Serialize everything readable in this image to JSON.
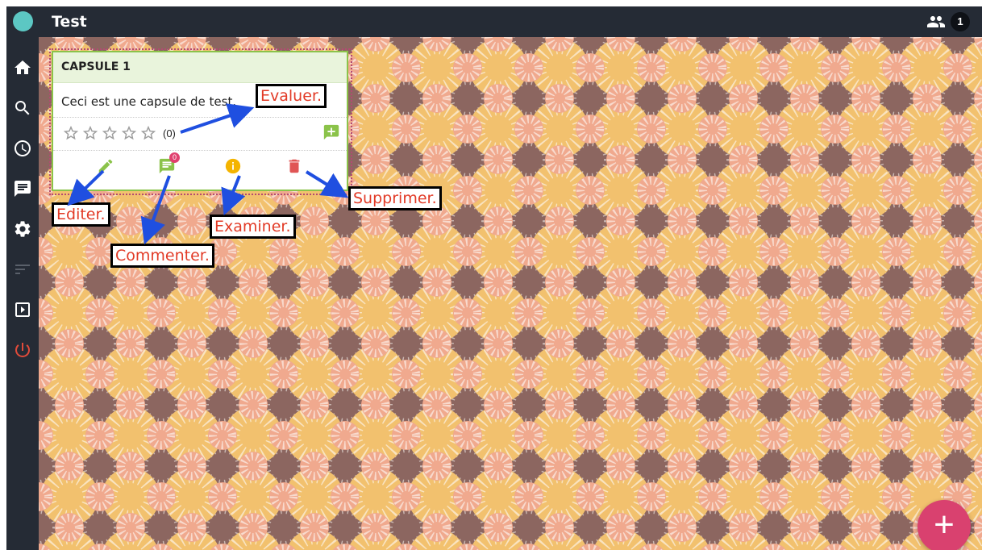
{
  "header": {
    "title": "Test",
    "online_users_count": "1",
    "users_icon": "group-icon"
  },
  "sidebar": {
    "items": [
      {
        "icon": "home-icon"
      },
      {
        "icon": "search-icon"
      },
      {
        "icon": "history-icon"
      },
      {
        "icon": "chat-icon"
      },
      {
        "icon": "settings-icon"
      },
      {
        "icon": "sort-icon"
      },
      {
        "icon": "slideshow-icon"
      },
      {
        "icon": "power-icon",
        "color": "#e04b3a"
      }
    ]
  },
  "capsule": {
    "title": "CAPSULE 1",
    "text": "Ceci est une capsule de test.",
    "rating_stars": 0,
    "rating_count": "(0)",
    "comment_count": "0",
    "header_color": "#e9f4dc",
    "border_color": "#8bc34a"
  },
  "annotations": {
    "evaluate": "Evaluer.",
    "edit": "Editer.",
    "comment": "Commenter.",
    "examine": "Examiner.",
    "delete": "Supprimer."
  },
  "fab": {
    "label": "+",
    "color": "#d9416f"
  },
  "colors": {
    "topbar": "#252b35",
    "accent": "#5cc7c3",
    "edit": "#8bc34a",
    "comment": "#8bc34a",
    "info": "#f4b400",
    "delete": "#e05555",
    "annotation_text": "#e23a26",
    "arrow": "#1f4fe0"
  }
}
